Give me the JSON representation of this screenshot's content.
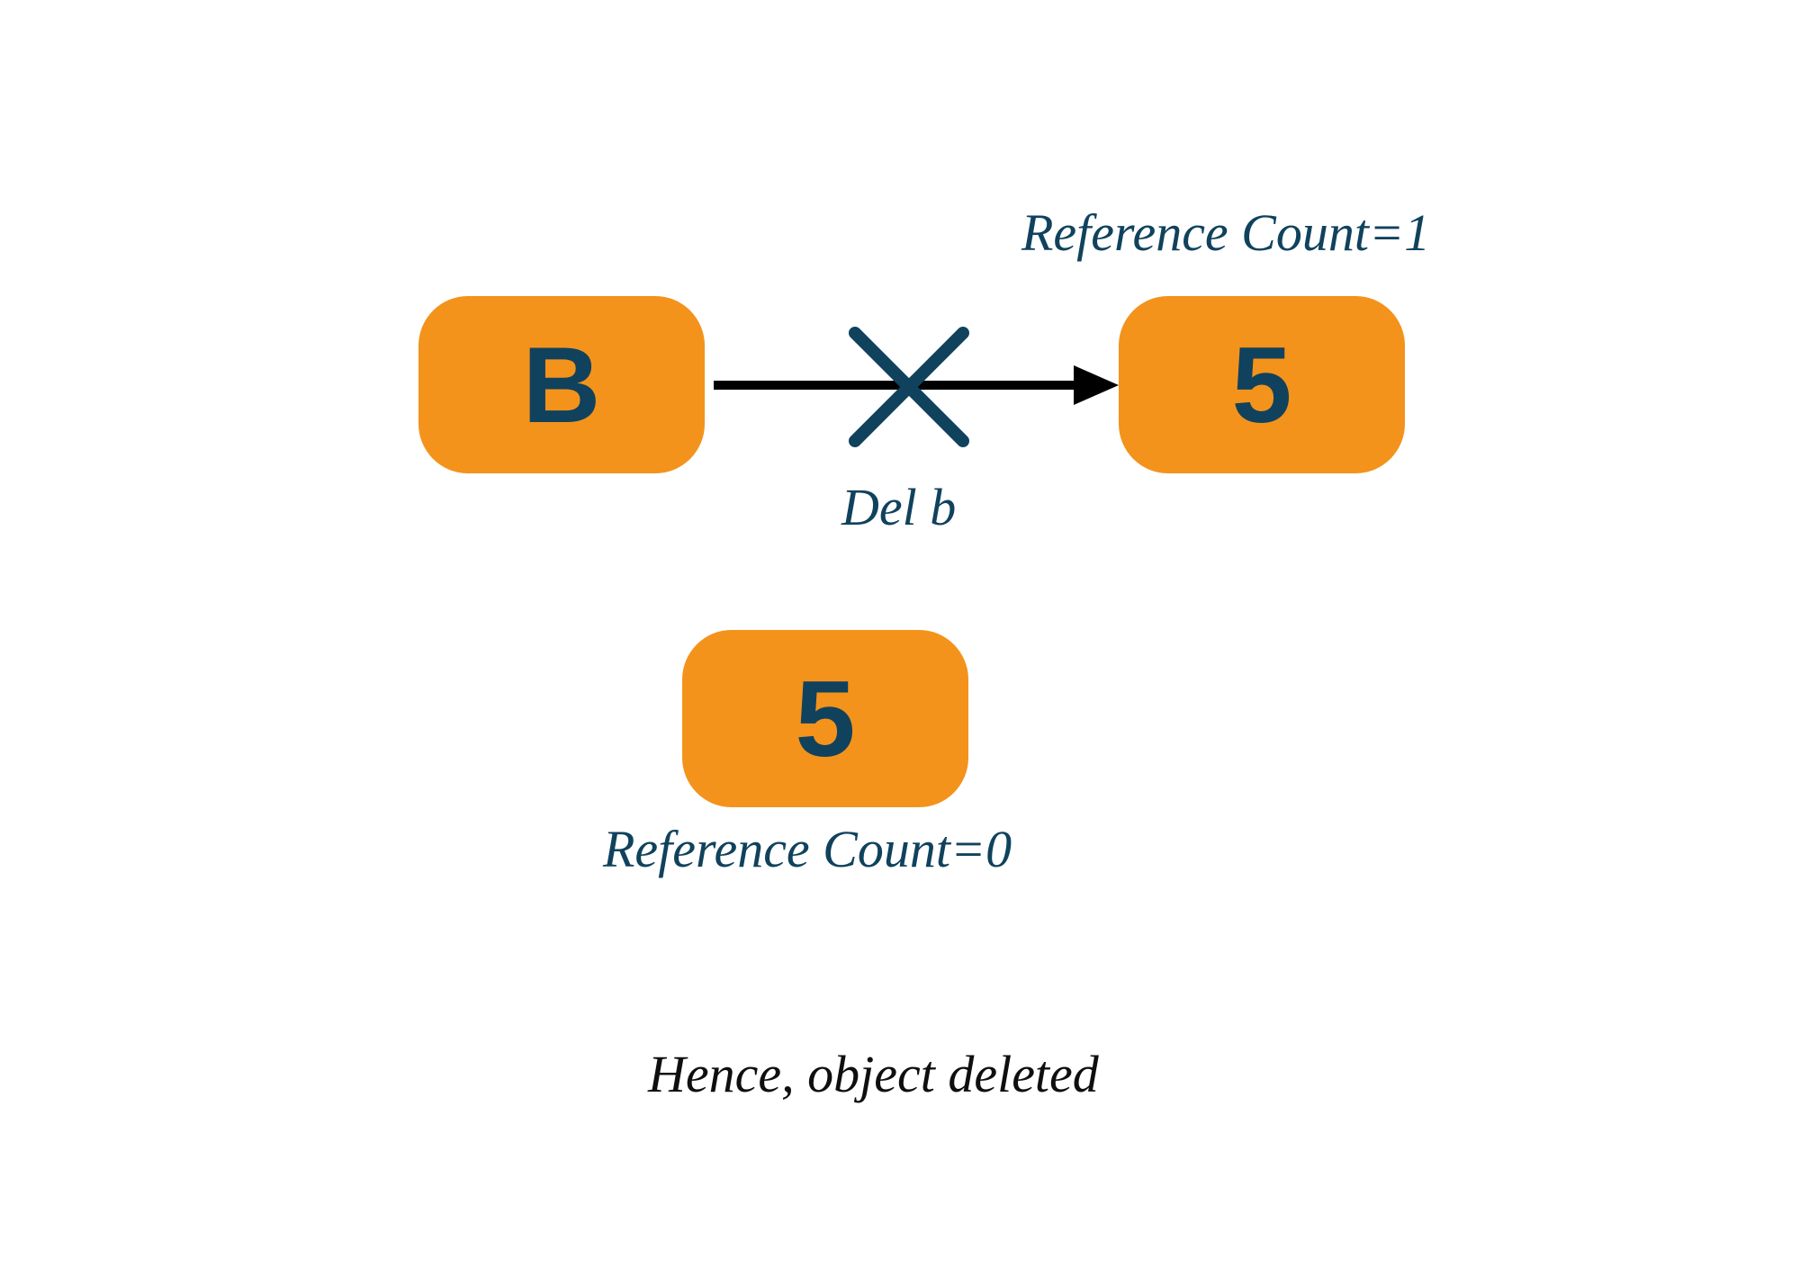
{
  "nodes": {
    "b": {
      "label": "B"
    },
    "five_top": {
      "label": "5"
    },
    "five_bottom": {
      "label": "5"
    }
  },
  "labels": {
    "ref_count_1": "Reference Count=1",
    "del_b": "Del b",
    "ref_count_0": "Reference Count=0",
    "conclusion": "Hence, object deleted"
  },
  "colors": {
    "node_bg": "#f3931c",
    "node_text": "#10425d",
    "label_text": "#10425d",
    "arrow": "#000000",
    "cross": "#10425d"
  }
}
